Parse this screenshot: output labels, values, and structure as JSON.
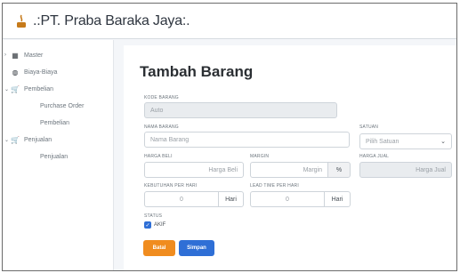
{
  "app": {
    "brand": ".:PT. Praba Baraka Jaya:."
  },
  "sidebar": {
    "items": [
      {
        "label": "Master",
        "icon": "grid-icon",
        "caret": "›"
      },
      {
        "label": "Biaya-Biaya",
        "icon": "coins-icon",
        "caret": ""
      },
      {
        "label": "Pembelian",
        "icon": "cart-icon",
        "caret": "⌄"
      },
      {
        "label": "Purchase Order",
        "sub": true
      },
      {
        "label": "Pembelian",
        "sub": true
      },
      {
        "label": "Penjualan",
        "icon": "cart-icon",
        "caret": "⌄"
      },
      {
        "label": "Penjualan",
        "sub": true
      }
    ]
  },
  "form": {
    "title": "Tambah Barang",
    "kode_barang": {
      "label": "KODE BARANG",
      "value": "Auto"
    },
    "nama_barang": {
      "label": "NAMA BARANG",
      "placeholder": "Nama Barang"
    },
    "satuan": {
      "label": "SATUAN",
      "selected": "Pilih Satuan"
    },
    "harga_beli": {
      "label": "HARGA BELI",
      "placeholder": "Harga Beli"
    },
    "margin": {
      "label": "MARGIN",
      "placeholder": "Margin",
      "addon": "%"
    },
    "harga_jual": {
      "label": "HARGA JUAL",
      "placeholder": "Harga Jual"
    },
    "kebutuhan": {
      "label": "KEBUTUHAN PER HARI",
      "value": "0",
      "addon": "Hari"
    },
    "lead_time": {
      "label": "LEAD TIME PER HARI",
      "value": "0",
      "addon": "Hari"
    },
    "status": {
      "label": "STATUS",
      "checkbox_label": "AKIF",
      "checked": true
    },
    "buttons": {
      "cancel": "Batal",
      "save": "Simpan"
    }
  },
  "colors": {
    "accent_blue": "#2f6fd6",
    "accent_orange": "#f08c1f"
  }
}
